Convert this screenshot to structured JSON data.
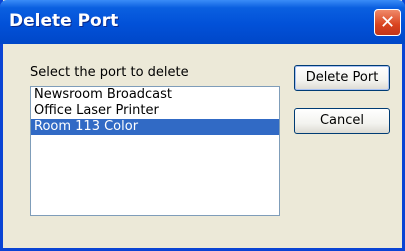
{
  "window": {
    "title": "Delete Port",
    "close_label": "✕"
  },
  "prompt": "Select the port to delete",
  "ports": [
    {
      "label": "Newsroom Broadcast",
      "selected": false
    },
    {
      "label": "Office Laser Printer",
      "selected": false
    },
    {
      "label": "Room 113 Color",
      "selected": true
    }
  ],
  "buttons": {
    "delete": "Delete Port",
    "cancel": "Cancel"
  },
  "colors": {
    "title_bar": "#0251d8",
    "selection": "#316ac5",
    "dialog_bg": "#ece9d8",
    "close_red": "#d9431f"
  },
  "icons": {
    "close": "close-icon"
  }
}
